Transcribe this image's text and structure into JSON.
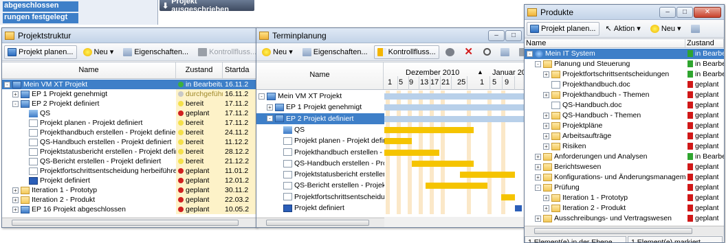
{
  "top_menu": {
    "item1": "abgeschlossen",
    "item2": "rungen festgelegt",
    "popup_button": "Projekt ausgeschrieben"
  },
  "projektstruktur": {
    "title": "Projektstruktur",
    "toolbar": {
      "projekt_planen": "Projekt planen...",
      "neu": "Neu",
      "eigenschaften": "Eigenschaften...",
      "kontrollfluss": "Kontrollfluss..."
    },
    "columns": {
      "name": "Name",
      "zustand": "Zustand",
      "start": "Startda"
    },
    "rows": [
      {
        "name": "Mein VM XT Projekt",
        "zustand": "in Bearbeitung",
        "start": "16.11.2",
        "status": "green",
        "icon": "proj",
        "level": 0,
        "exp": "-",
        "sel": true
      },
      {
        "name": "EP 1 Projekt genehmigt",
        "zustand": "durchgeführt",
        "start": "16.11.2",
        "status": "gray",
        "icon": "proj",
        "level": 1,
        "exp": "+"
      },
      {
        "name": "EP 2 Projekt definiert",
        "zustand": "bereit",
        "start": "17.11.2",
        "status": "yellow",
        "icon": "proj",
        "level": 1,
        "exp": "-"
      },
      {
        "name": "QS",
        "zustand": "geplant",
        "start": "17.11.2",
        "status": "red",
        "icon": "qs",
        "level": 2,
        "exp": ""
      },
      {
        "name": "Projekt planen - Projekt definiert",
        "zustand": "bereit",
        "start": "17.11.2",
        "status": "yellow",
        "icon": "doc",
        "level": 2,
        "exp": ""
      },
      {
        "name": "Projekthandbuch erstellen - Projekt definiert",
        "zustand": "bereit",
        "start": "24.11.2",
        "status": "yellow",
        "icon": "doc",
        "level": 2,
        "exp": ""
      },
      {
        "name": "QS-Handbuch erstellen - Projekt definiert",
        "zustand": "bereit",
        "start": "11.12.2",
        "status": "yellow",
        "icon": "doc",
        "level": 2,
        "exp": ""
      },
      {
        "name": "Projektstatusbericht erstellen - Projekt defini",
        "zustand": "bereit",
        "start": "28.12.2",
        "status": "yellow",
        "icon": "doc",
        "level": 2,
        "exp": ""
      },
      {
        "name": "QS-Bericht erstellen - Projekt definiert",
        "zustand": "bereit",
        "start": "21.12.2",
        "status": "yellow",
        "icon": "doc",
        "level": 2,
        "exp": ""
      },
      {
        "name": "Projektfortschrittsentscheidung herbeiführer",
        "zustand": "geplant",
        "start": "11.01.2",
        "status": "red",
        "icon": "doc",
        "level": 2,
        "exp": ""
      },
      {
        "name": "Projekt definiert",
        "zustand": "geplant",
        "start": "12.01.2",
        "status": "red",
        "icon": "blue",
        "level": 2,
        "exp": ""
      },
      {
        "name": "Iteration 1 - Prototyp",
        "zustand": "geplant",
        "start": "30.11.2",
        "status": "red",
        "icon": "folder",
        "level": 1,
        "exp": "+"
      },
      {
        "name": "Iteration 2 - Produkt",
        "zustand": "geplant",
        "start": "22.03.2",
        "status": "red",
        "icon": "folder",
        "level": 1,
        "exp": "+"
      },
      {
        "name": "EP 16 Projekt abgeschlossen",
        "zustand": "geplant",
        "start": "10.05.2",
        "status": "red",
        "icon": "proj",
        "level": 1,
        "exp": "+"
      }
    ]
  },
  "terminplanung": {
    "title": "Terminplanung",
    "toolbar": {
      "neu": "Neu",
      "eigenschaften": "Eigenschaften...",
      "kontrollfluss": "Kontrollfluss..."
    },
    "columns": {
      "name": "Name",
      "month1": "Dezember 2010",
      "month2": "Januar 2011"
    },
    "days": [
      "1",
      "5",
      "9",
      "13",
      "17",
      "21",
      "25",
      "1",
      "5",
      "9"
    ],
    "rows": [
      {
        "name": "Mein VM XT Projekt",
        "icon": "proj",
        "level": 0,
        "exp": "-"
      },
      {
        "name": "EP 1 Projekt genehmigt",
        "icon": "proj",
        "level": 1,
        "exp": "+"
      },
      {
        "name": "EP 2 Projekt definiert",
        "icon": "proj",
        "level": 1,
        "exp": "-",
        "sel": true
      },
      {
        "name": "QS",
        "icon": "qs",
        "level": 2,
        "exp": ""
      },
      {
        "name": "Projekt planen - Projekt definie",
        "icon": "doc",
        "level": 2,
        "exp": ""
      },
      {
        "name": "Projekthandbuch erstellen - Pr",
        "icon": "doc",
        "level": 2,
        "exp": ""
      },
      {
        "name": "QS-Handbuch erstellen - Proje",
        "icon": "doc",
        "level": 2,
        "exp": ""
      },
      {
        "name": "Projektstatusbericht erstellen -",
        "icon": "doc",
        "level": 2,
        "exp": ""
      },
      {
        "name": "QS-Bericht erstellen - Projekt c",
        "icon": "doc",
        "level": 2,
        "exp": ""
      },
      {
        "name": "Projektfortschrittsentscheidung",
        "icon": "doc",
        "level": 2,
        "exp": ""
      },
      {
        "name": "Projekt definiert",
        "icon": "blue",
        "level": 2,
        "exp": ""
      }
    ]
  },
  "produkte": {
    "title": "Produkte",
    "toolbar": {
      "projekt_planen": "Projekt planen...",
      "aktion": "Aktion",
      "neu": "Neu"
    },
    "columns": {
      "name": "Name",
      "zustand": "Zustand"
    },
    "rows": [
      {
        "name": "Mein IT System",
        "zustand": "in Bearbeitu",
        "status": "green",
        "icon": "sys",
        "level": 0,
        "exp": "-",
        "sel": true
      },
      {
        "name": "Planung und Steuerung",
        "zustand": "in Bearbeitu",
        "status": "green",
        "icon": "folder",
        "level": 1,
        "exp": "-"
      },
      {
        "name": "Projektfortschrittsentscheidungen",
        "zustand": "in Bearbeitu",
        "status": "green",
        "icon": "folder",
        "level": 2,
        "exp": "+"
      },
      {
        "name": "Projekthandbuch.doc",
        "zustand": "geplant",
        "status": "red",
        "icon": "doc",
        "level": 2,
        "exp": ""
      },
      {
        "name": "Projekthandbuch - Themen",
        "zustand": "geplant",
        "status": "red",
        "icon": "folder",
        "level": 2,
        "exp": "+"
      },
      {
        "name": "QS-Handbuch.doc",
        "zustand": "geplant",
        "status": "red",
        "icon": "doc",
        "level": 2,
        "exp": ""
      },
      {
        "name": "QS-Handbuch - Themen",
        "zustand": "geplant",
        "status": "red",
        "icon": "folder",
        "level": 2,
        "exp": "+"
      },
      {
        "name": "Projektpläne",
        "zustand": "geplant",
        "status": "red",
        "icon": "folder",
        "level": 2,
        "exp": "+"
      },
      {
        "name": "Arbeitsaufträge",
        "zustand": "geplant",
        "status": "red",
        "icon": "folder",
        "level": 2,
        "exp": "+"
      },
      {
        "name": "Risiken",
        "zustand": "geplant",
        "status": "red",
        "icon": "folder",
        "level": 2,
        "exp": "+"
      },
      {
        "name": "Anforderungen und Analysen",
        "zustand": "in Bearbeitu",
        "status": "green",
        "icon": "folder",
        "level": 1,
        "exp": "+"
      },
      {
        "name": "Berichtswesen",
        "zustand": "geplant",
        "status": "red",
        "icon": "folder",
        "level": 1,
        "exp": "+"
      },
      {
        "name": "Konfigurations- und Änderungsmanagem",
        "zustand": "geplant",
        "status": "red",
        "icon": "folder",
        "level": 1,
        "exp": "+"
      },
      {
        "name": "Prüfung",
        "zustand": "geplant",
        "status": "red",
        "icon": "folder",
        "level": 1,
        "exp": "-"
      },
      {
        "name": "Iteration 1 - Prototyp",
        "zustand": "geplant",
        "status": "red",
        "icon": "folder",
        "level": 2,
        "exp": "+"
      },
      {
        "name": "Iteration 2 - Produkt",
        "zustand": "geplant",
        "status": "red",
        "icon": "folder",
        "level": 2,
        "exp": "+"
      },
      {
        "name": "Ausschreibungs- und Vertragswesen",
        "zustand": "geplant",
        "status": "red",
        "icon": "folder",
        "level": 1,
        "exp": "+"
      }
    ],
    "status_left": "1 Element(e) in der Ebene",
    "status_right": "1 Element(e) markiert"
  }
}
